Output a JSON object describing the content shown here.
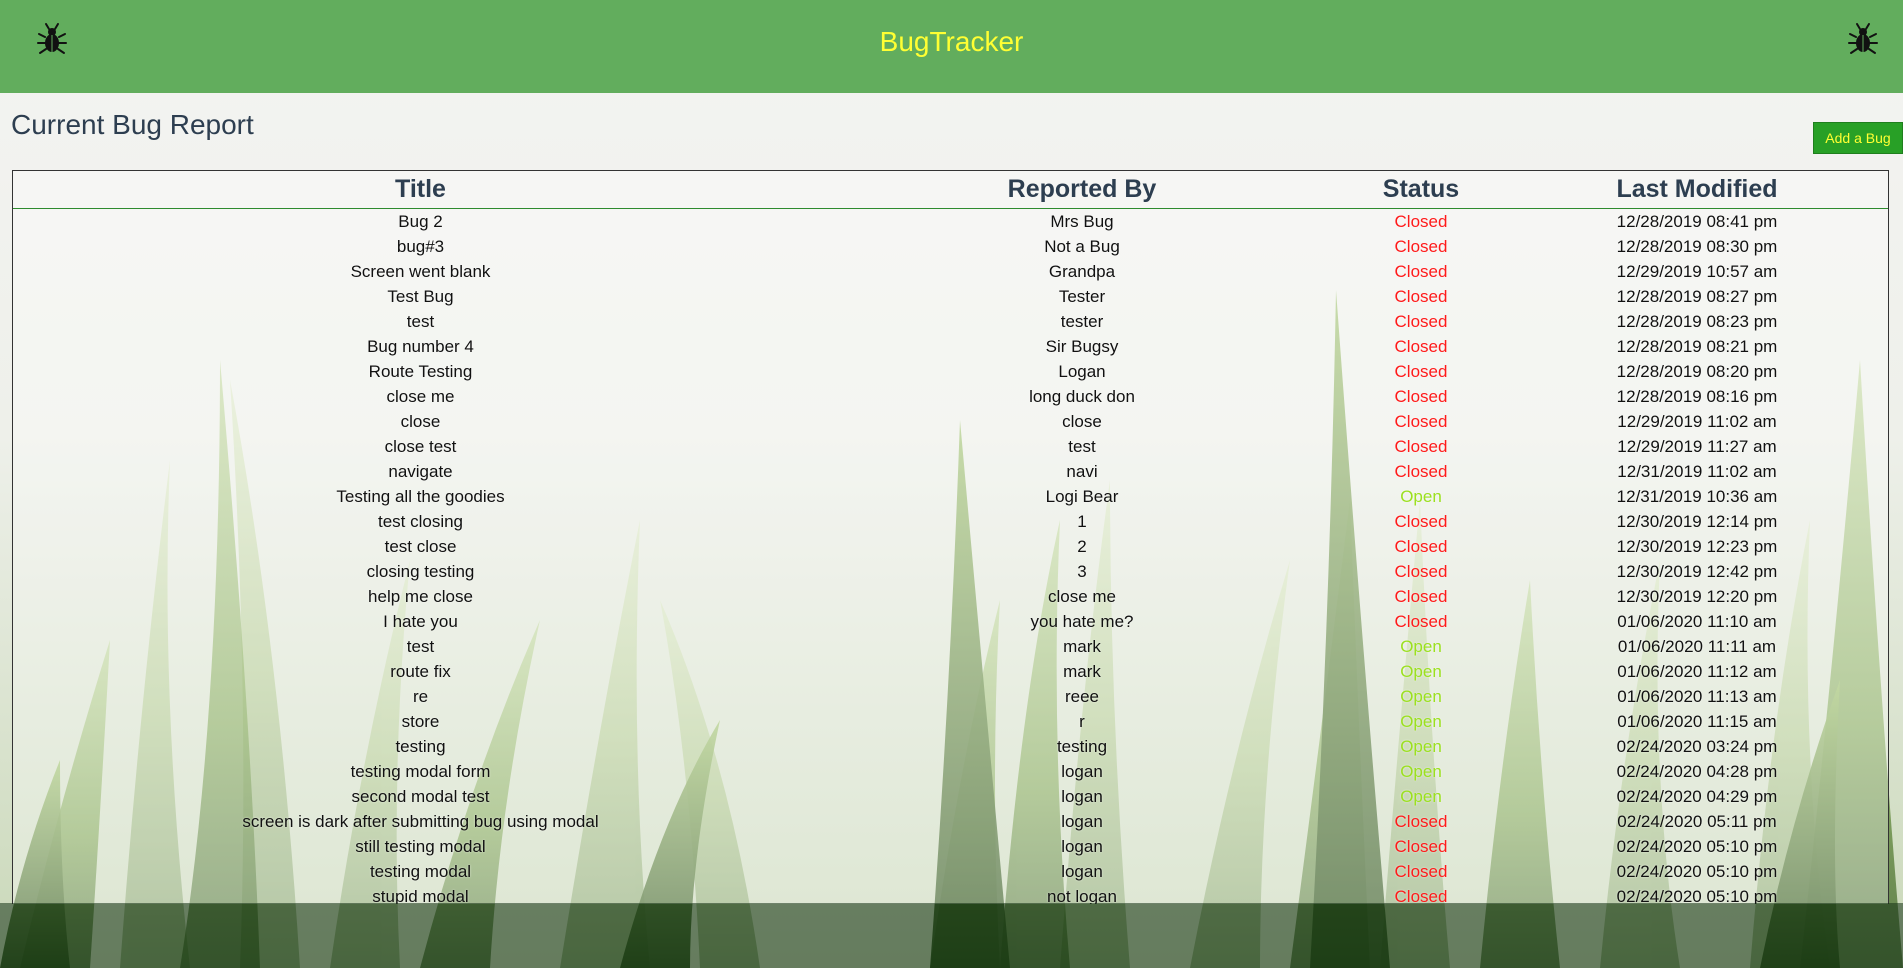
{
  "header": {
    "brand": "BugTracker",
    "left_icon": "bug-icon",
    "right_icon": "bug-icon",
    "background": "#62ad5d",
    "brand_color": "#ffff33"
  },
  "page": {
    "title": "Current Bug Report",
    "add_button_label": "Add a Bug"
  },
  "table": {
    "columns": [
      "Title",
      "Reported By",
      "Status",
      "Last Modified"
    ],
    "status_colors": {
      "Closed": "#ff1a1a",
      "Open": "#9be01f"
    },
    "rows": [
      {
        "title": "Bug 2",
        "reporter": "Mrs Bug",
        "status": "Closed",
        "modified": "12/28/2019 08:41 pm"
      },
      {
        "title": "bug#3",
        "reporter": "Not a Bug",
        "status": "Closed",
        "modified": "12/28/2019 08:30 pm"
      },
      {
        "title": "Screen went blank",
        "reporter": "Grandpa",
        "status": "Closed",
        "modified": "12/29/2019 10:57 am"
      },
      {
        "title": "Test Bug",
        "reporter": "Tester",
        "status": "Closed",
        "modified": "12/28/2019 08:27 pm"
      },
      {
        "title": "test",
        "reporter": "tester",
        "status": "Closed",
        "modified": "12/28/2019 08:23 pm"
      },
      {
        "title": "Bug number 4",
        "reporter": "Sir Bugsy",
        "status": "Closed",
        "modified": "12/28/2019 08:21 pm"
      },
      {
        "title": "Route Testing",
        "reporter": "Logan",
        "status": "Closed",
        "modified": "12/28/2019 08:20 pm"
      },
      {
        "title": "close me",
        "reporter": "long duck don",
        "status": "Closed",
        "modified": "12/28/2019 08:16 pm"
      },
      {
        "title": "close",
        "reporter": "close",
        "status": "Closed",
        "modified": "12/29/2019 11:02 am"
      },
      {
        "title": "close test",
        "reporter": "test",
        "status": "Closed",
        "modified": "12/29/2019 11:27 am"
      },
      {
        "title": "navigate",
        "reporter": "navi",
        "status": "Closed",
        "modified": "12/31/2019 11:02 am"
      },
      {
        "title": "Testing all the goodies",
        "reporter": "Logi Bear",
        "status": "Open",
        "modified": "12/31/2019 10:36 am"
      },
      {
        "title": "test closing",
        "reporter": "1",
        "status": "Closed",
        "modified": "12/30/2019 12:14 pm"
      },
      {
        "title": "test close",
        "reporter": "2",
        "status": "Closed",
        "modified": "12/30/2019 12:23 pm"
      },
      {
        "title": "closing testing",
        "reporter": "3",
        "status": "Closed",
        "modified": "12/30/2019 12:42 pm"
      },
      {
        "title": "help me close",
        "reporter": "close me",
        "status": "Closed",
        "modified": "12/30/2019 12:20 pm"
      },
      {
        "title": "I hate you",
        "reporter": "you hate me?",
        "status": "Closed",
        "modified": "01/06/2020 11:10 am"
      },
      {
        "title": "test",
        "reporter": "mark",
        "status": "Open",
        "modified": "01/06/2020 11:11 am"
      },
      {
        "title": "route fix",
        "reporter": "mark",
        "status": "Open",
        "modified": "01/06/2020 11:12 am"
      },
      {
        "title": "re",
        "reporter": "reee",
        "status": "Open",
        "modified": "01/06/2020 11:13 am"
      },
      {
        "title": "store",
        "reporter": "r",
        "status": "Open",
        "modified": "01/06/2020 11:15 am"
      },
      {
        "title": "testing",
        "reporter": "testing",
        "status": "Open",
        "modified": "02/24/2020 03:24 pm"
      },
      {
        "title": "testing modal form",
        "reporter": "logan",
        "status": "Open",
        "modified": "02/24/2020 04:28 pm"
      },
      {
        "title": "second modal test",
        "reporter": "logan",
        "status": "Open",
        "modified": "02/24/2020 04:29 pm"
      },
      {
        "title": "screen is dark after submitting bug using modal",
        "reporter": "logan",
        "status": "Closed",
        "modified": "02/24/2020 05:11 pm"
      },
      {
        "title": "still testing modal",
        "reporter": "logan",
        "status": "Closed",
        "modified": "02/24/2020 05:10 pm"
      },
      {
        "title": "testing modal",
        "reporter": "logan",
        "status": "Closed",
        "modified": "02/24/2020 05:10 pm"
      },
      {
        "title": "stupid modal",
        "reporter": "not logan",
        "status": "Closed",
        "modified": "02/24/2020 05:10 pm"
      }
    ]
  }
}
